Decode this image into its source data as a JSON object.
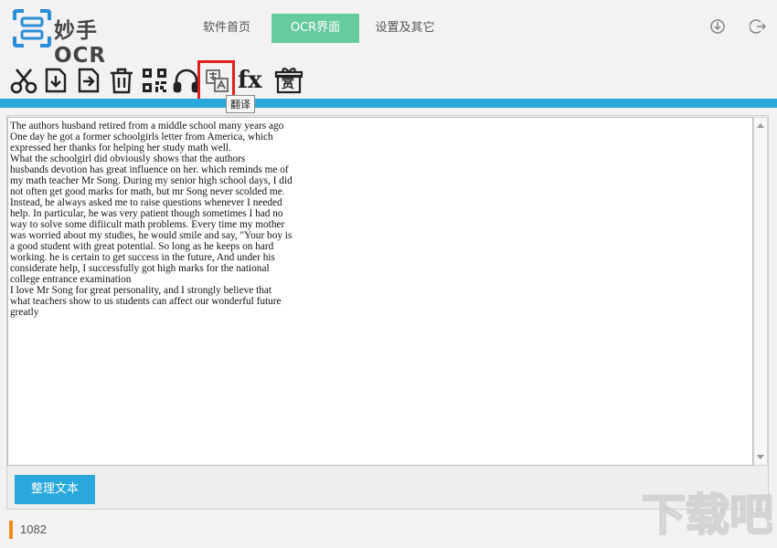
{
  "app": {
    "logo_text": "妙手OCR"
  },
  "nav": {
    "tabs": [
      {
        "label": "软件首页",
        "active": false
      },
      {
        "label": "OCR界面",
        "active": true
      },
      {
        "label": "设置及其它",
        "active": false
      }
    ]
  },
  "window_controls": [
    "download-icon",
    "logout-icon"
  ],
  "toolbar": {
    "tools": [
      "scissors-icon",
      "import-file-icon",
      "export-file-icon",
      "trash-icon",
      "qr-code-icon",
      "headphones-icon",
      "translate-icon",
      "formula-icon",
      "gift-icon"
    ],
    "gift_label": "赏",
    "formula_label": "fx",
    "tooltip": "翻译",
    "highlighted_tool": "translate-icon"
  },
  "editor": {
    "lines": [
      "The authors husband retired from a middle school many years ago",
      "One day he got a former schoolgirls letter from America, which",
      "expressed her thanks for helping her study math well.",
      "What the schoolgirl did obviously shows that the authors",
      "husbands devotion has great influence on her. which reminds me of",
      "my math teacher Mr Song. During my senior high school days, I did",
      "not often get good marks for math, but mr Song never scolded me.",
      "Instead, he always asked me to raise questions whenever I needed",
      "help. In particular, he was very patient though sometimes I had no",
      "way to solve some difiicult math problems. Every time my mother",
      "was worried about my studies, he would smile and say, \"Your boy is",
      "a good student with great potential. So long as he keeps on hard",
      "working. he is certain to get success in the future, And under his",
      "considerate help, I successfully got high marks for the national",
      "college entrance examination",
      "I love Mr Song for great personality, and I strongly believe that",
      "what teachers show to us students can affect our wonderful future",
      "greatly"
    ]
  },
  "actions": {
    "tidy_text_label": "整理文本"
  },
  "status": {
    "count": "1082"
  },
  "watermark": {
    "text": "下载吧"
  },
  "colors": {
    "accent_green": "#67cba0",
    "accent_blue": "#2aa8dc",
    "highlight_red": "#e02020",
    "status_orange": "#f08a1c"
  }
}
